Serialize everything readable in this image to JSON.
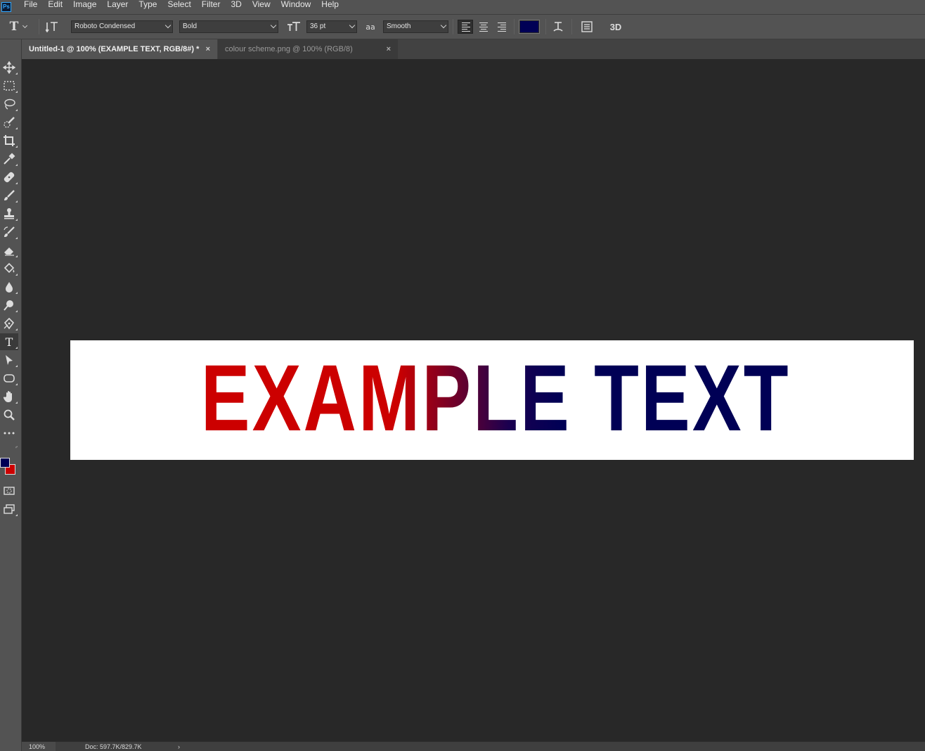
{
  "app": {
    "logo_text": "Ps",
    "accent_color": "#31a8ff"
  },
  "menu": [
    "File",
    "Edit",
    "Image",
    "Layer",
    "Type",
    "Select",
    "Filter",
    "3D",
    "View",
    "Window",
    "Help"
  ],
  "options": {
    "font_family": "Roboto Condensed",
    "font_style": "Bold",
    "font_size": "36 pt",
    "antialias": "Smooth",
    "text_color": "#000055",
    "three_d_label": "3D",
    "type_tool_glyph": "T",
    "size_icon_glyph": "ıT"
  },
  "tabs": [
    {
      "title": "Untitled-1 @ 100% (EXAMPLE TEXT, RGB/8#) *",
      "close": "×",
      "active": true
    },
    {
      "title": "colour scheme.png @ 100% (RGB/8)",
      "close": "×",
      "active": false
    }
  ],
  "toolbar": {
    "active_tool": "type-tool",
    "foreground_color": "#000055",
    "background_color": "#cc0000"
  },
  "document": {
    "text": "EXAMPLE TEXT",
    "gradient_start": "#cc0000",
    "gradient_end": "#000055"
  },
  "status": {
    "zoom": "100%",
    "doc_info": "Doc: 597.7K/829.7K",
    "arrow": "›"
  }
}
